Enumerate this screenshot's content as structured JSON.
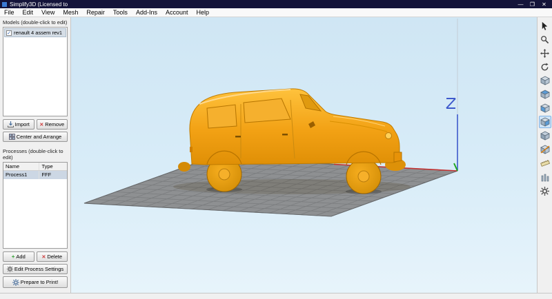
{
  "window": {
    "title": "Simplify3D (Licensed to",
    "minimize_glyph": "—",
    "maximize_glyph": "❐",
    "close_glyph": "✕"
  },
  "menu": {
    "items": [
      "File",
      "Edit",
      "View",
      "Mesh",
      "Repair",
      "Tools",
      "Add-Ins",
      "Account",
      "Help"
    ]
  },
  "models_panel": {
    "label": "Models (double-click to edit)",
    "items": [
      {
        "name": "renault 4 assem rev1",
        "check_glyph": "✓"
      }
    ],
    "import_button": "Import",
    "remove_button": "Remove",
    "center_arrange_button": "Center and Arrange"
  },
  "processes_panel": {
    "label": "Processes (double-click to edit)",
    "headers": [
      "Name",
      "Type"
    ],
    "rows": [
      {
        "name": "Process1",
        "type": "FFF"
      }
    ],
    "add_button": "Add",
    "delete_button": "Delete",
    "edit_button": "Edit Process Settings",
    "prepare_button": "Prepare to Print!"
  },
  "viewport": {
    "axis_z_label": "Z"
  },
  "right_toolbar": {
    "icons": [
      "select-cursor",
      "zoom",
      "pan",
      "rotate-view",
      "default-view",
      "top-view",
      "front-view",
      "side-view",
      "iso-view",
      "cross-section",
      "ruler",
      "supports",
      "machine-control"
    ]
  },
  "colors": {
    "titlebar": "#14143a",
    "viewport_top": "#cfe6f4",
    "viewport_bottom": "#e7f4fb",
    "model_orange": "#f2a114",
    "plate_gray": "#8e9092",
    "axis_red": "#c23232",
    "axis_green": "#1fa51f",
    "axis_blue": "#3d59cc",
    "selection_bg": "#ccd7e4"
  }
}
